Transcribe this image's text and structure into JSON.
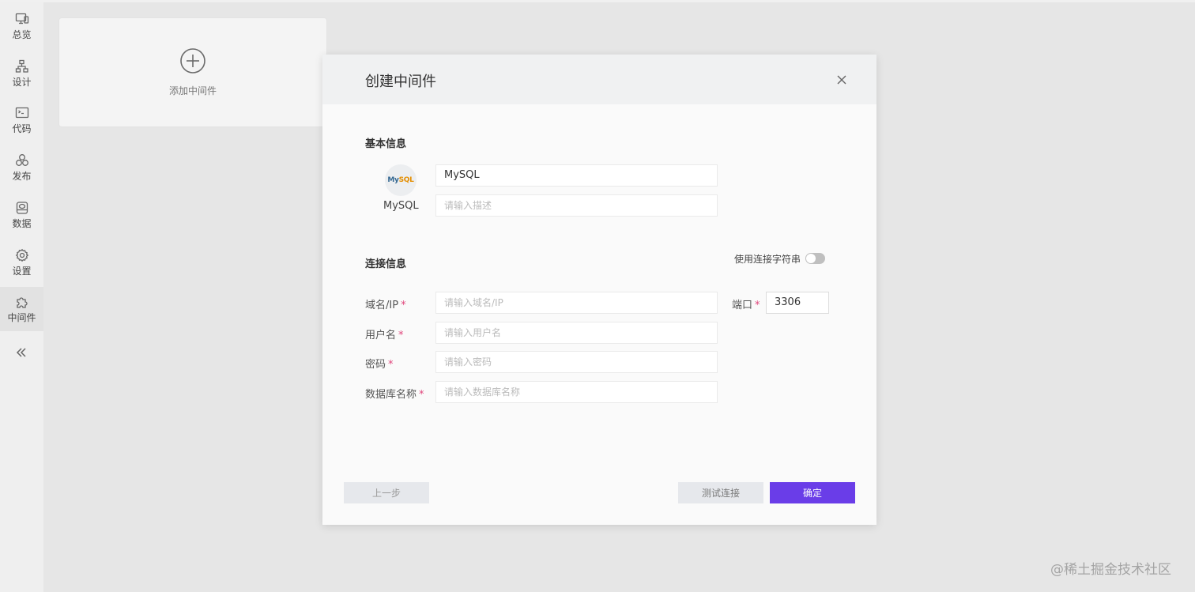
{
  "sidebar": {
    "items": [
      {
        "label": "总览",
        "icon": "monitor-icon"
      },
      {
        "label": "设计",
        "icon": "sitemap-icon"
      },
      {
        "label": "代码",
        "icon": "terminal-icon"
      },
      {
        "label": "发布",
        "icon": "cluster-icon"
      },
      {
        "label": "数据",
        "icon": "database-icon"
      },
      {
        "label": "设置",
        "icon": "gear-icon"
      },
      {
        "label": "中间件",
        "icon": "puzzle-icon",
        "active": true
      }
    ],
    "collapse_icon": "double-chevron-left-icon"
  },
  "add_card": {
    "label": "添加中间件",
    "icon": "plus-circle-icon"
  },
  "modal": {
    "title": "创建中间件",
    "basic_section": "基本信息",
    "logo_caption": "MySQL",
    "logo_text_my": "My",
    "logo_text_sql": "SQL",
    "name_value": "MySQL",
    "desc_placeholder": "请输入描述",
    "connect_section": "连接信息",
    "use_connection_string": "使用连接字符串",
    "fields": {
      "host_label": "域名/IP",
      "host_placeholder": "请输入域名/IP",
      "port_label": "端口",
      "port_value": "3306",
      "user_label": "用户名",
      "user_placeholder": "请输入用户名",
      "password_label": "密码",
      "password_placeholder": "请输入密码",
      "db_label": "数据库名称",
      "db_placeholder": "请输入数据库名称"
    },
    "required_mark": "*",
    "buttons": {
      "prev": "上一步",
      "test": "测试连接",
      "ok": "确定"
    }
  },
  "watermark": "@稀土掘金技术社区",
  "colors": {
    "accent": "#6a3de8",
    "required": "#e0457b"
  }
}
